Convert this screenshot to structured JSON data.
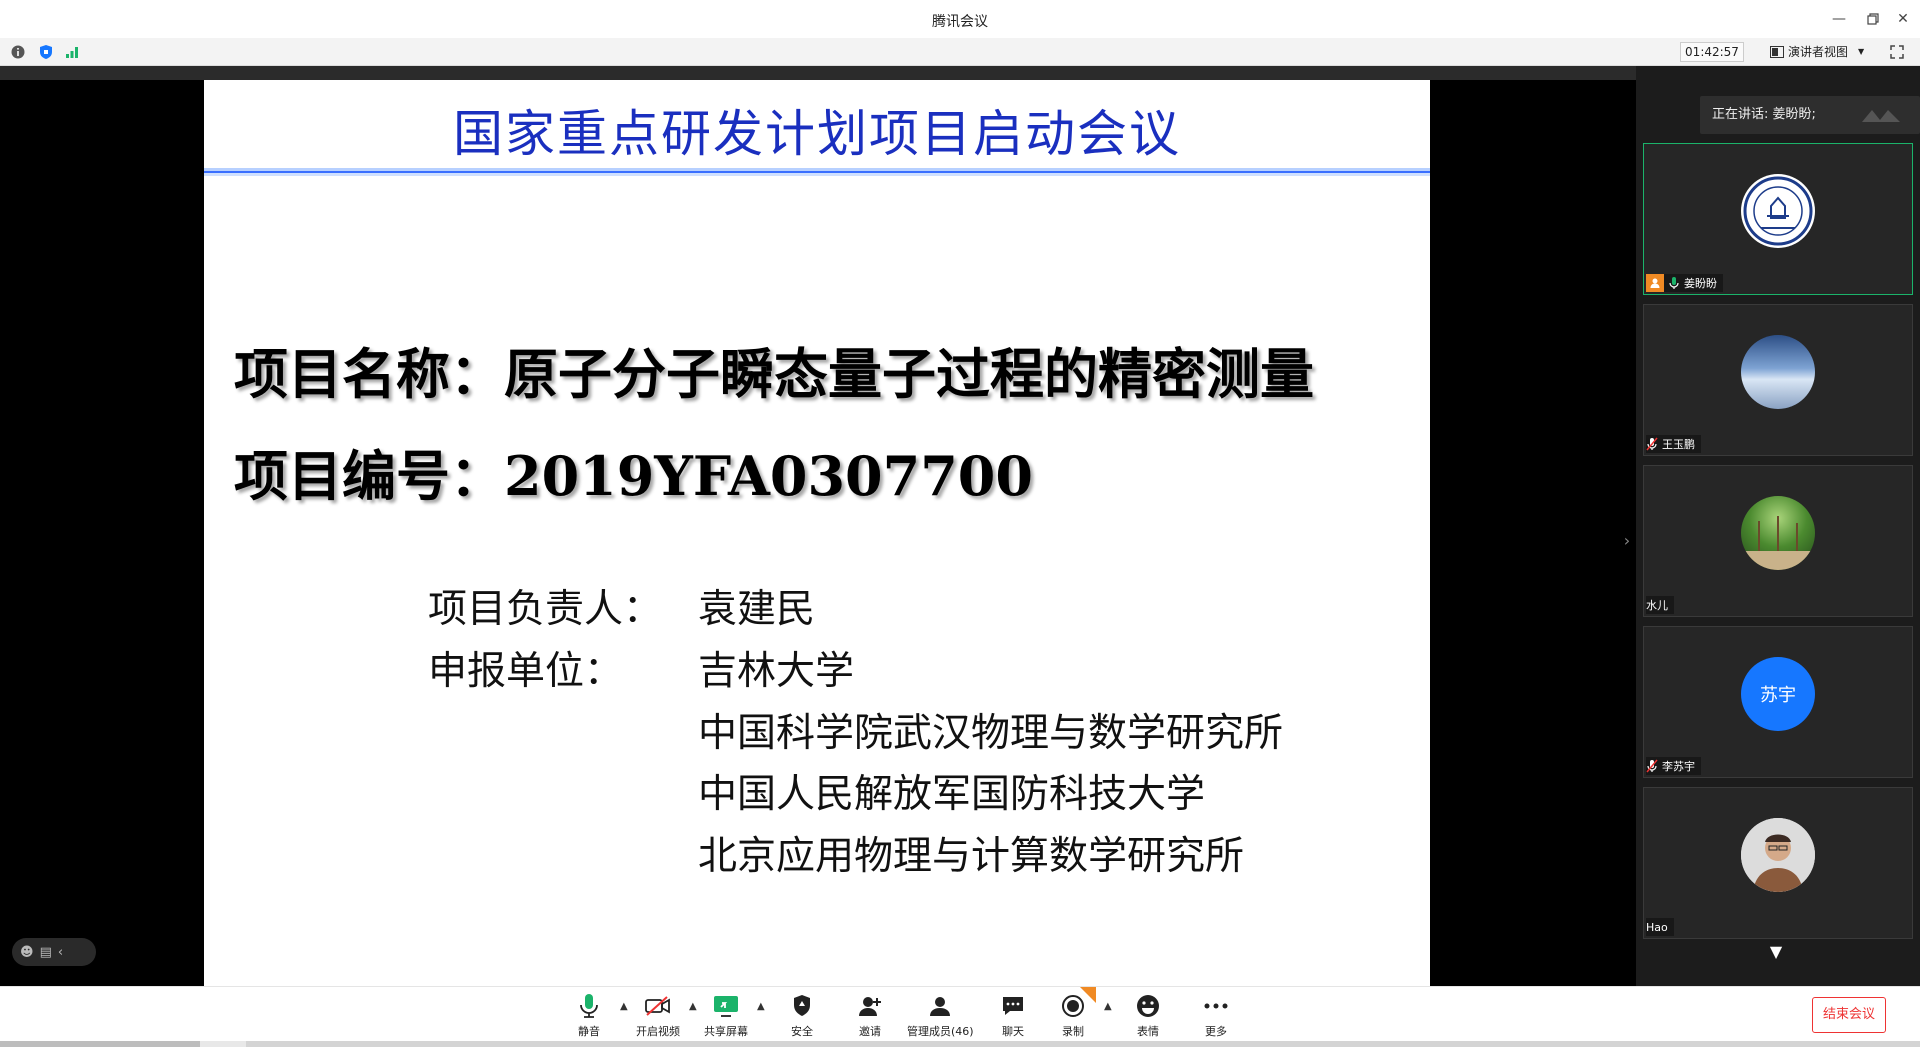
{
  "window": {
    "title": "腾讯会议"
  },
  "infobar": {
    "timer": "01:42:57",
    "view_label": "演讲者视图"
  },
  "slide": {
    "title": "国家重点研发计划项目启动会议",
    "project_name": "项目名称：原子分子瞬态量子过程的精密测量",
    "project_number": "项目编号：2019YFA0307700",
    "leader_label": "项目负责人：",
    "leader_value": "袁建民",
    "unit_label": "申报单位：",
    "units": [
      "吉林大学",
      "中国科学院武汉物理与数学研究所",
      "中国人民解放军国防科技大学",
      "北京应用物理与计算数学研究所"
    ]
  },
  "right_panel": {
    "speaking": "正在讲话: 姜盼盼;",
    "participants": [
      {
        "name": "姜盼盼",
        "active": true,
        "avatar": "university-seal"
      },
      {
        "name": "王玉鹏",
        "active": false,
        "avatar": "sky-photo",
        "muted": true
      },
      {
        "name": "水儿",
        "active": false,
        "avatar": "trees-photo"
      },
      {
        "name": "李苏宇",
        "active": false,
        "avatar_text": "苏宇",
        "muted": true
      },
      {
        "name": "Hao",
        "active": false,
        "avatar": "person-photo"
      }
    ]
  },
  "toolbar": {
    "mute": "静音",
    "video": "开启视频",
    "share": "共享屏幕",
    "security": "安全",
    "invite": "邀请",
    "members": "管理成员(46)",
    "chat": "聊天",
    "record": "录制",
    "emoji": "表情",
    "more": "更多",
    "end": "结束会议"
  },
  "colors": {
    "slide_title": "#1a2fbf",
    "accent_green": "#1bb36a",
    "end_red": "#e33333",
    "avatar_blue": "#1677ff"
  }
}
